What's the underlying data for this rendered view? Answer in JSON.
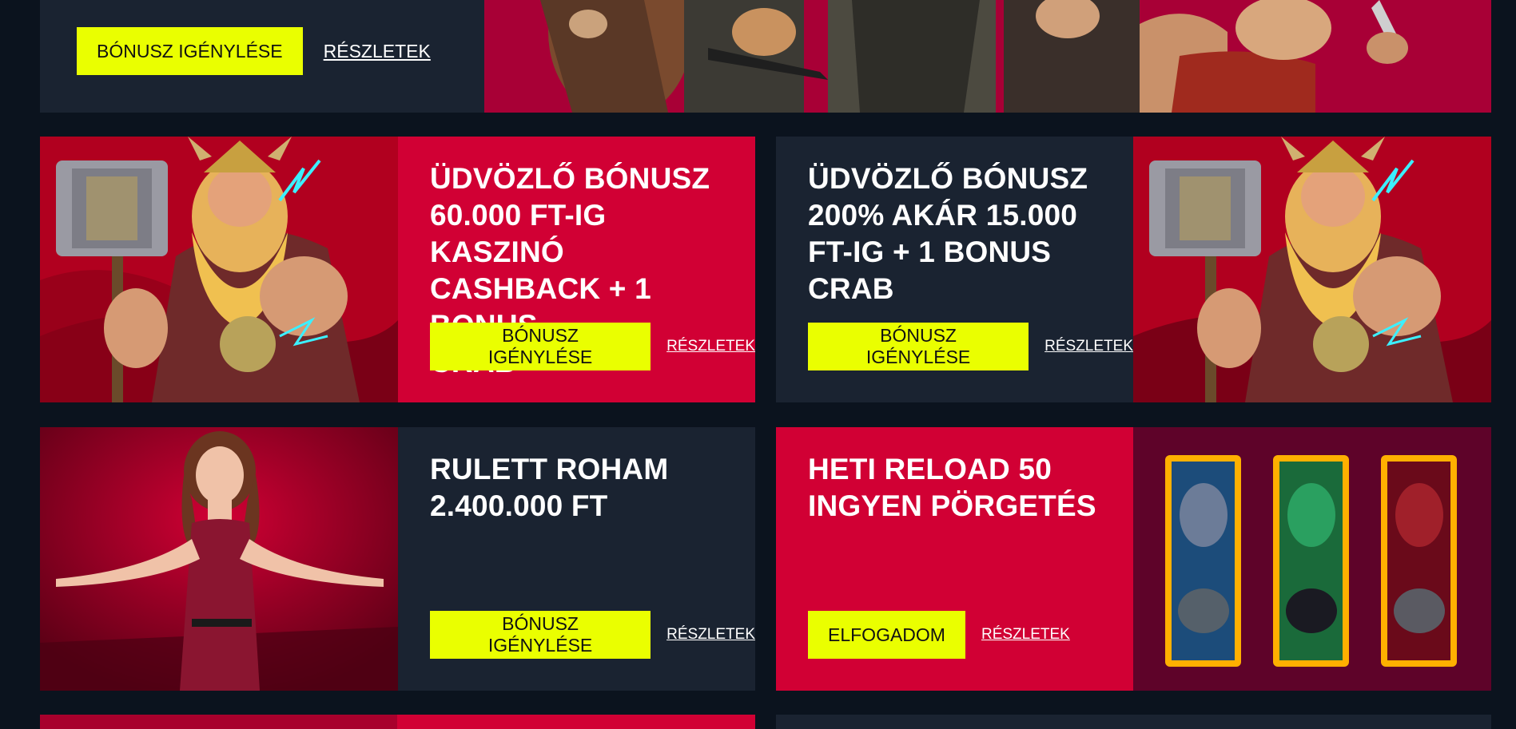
{
  "colors": {
    "page_bg": "#0b131e",
    "panel_navy": "#1a2331",
    "panel_red": "#d10034",
    "button_yellow": "#eaff00"
  },
  "top_card": {
    "claim_button": "BÓNUSZ IGÉNYLÉSE",
    "details_link": "RÉSZLETEK",
    "image": "cowboys-banner-art"
  },
  "cards": [
    {
      "title_lines": [
        "ÜDVÖZLŐ BÓNUSZ",
        "60.000 FT-IG KASZINÓ",
        "CASHBACK + 1 BONUS",
        "CRAB"
      ],
      "button": "BÓNUSZ IGÉNYLÉSE",
      "link": "RÉSZLETEK",
      "image": "viking-god-with-hammer-art"
    },
    {
      "title_lines": [
        "ÜDVÖZLŐ BÓNUSZ",
        "200% AKÁR 15.000",
        "FT-IG + 1 BONUS CRAB"
      ],
      "button": "BÓNUSZ IGÉNYLÉSE",
      "link": "RÉSZLETEK",
      "image": "viking-god-with-hammer-art"
    },
    {
      "title_lines": [
        "RULETT ROHAM",
        "2.400.000 FT"
      ],
      "button": "BÓNUSZ IGÉNYLÉSE",
      "link": "RÉSZLETEK",
      "image": "woman-in-red-dress-art"
    },
    {
      "title_lines": [
        "HETI RELOAD 50",
        "INGYEN PÖRGETÉS"
      ],
      "button": "ELFOGADOM",
      "link": "RÉSZLETEK",
      "image": "three-warrior-slot-reels-art"
    }
  ]
}
